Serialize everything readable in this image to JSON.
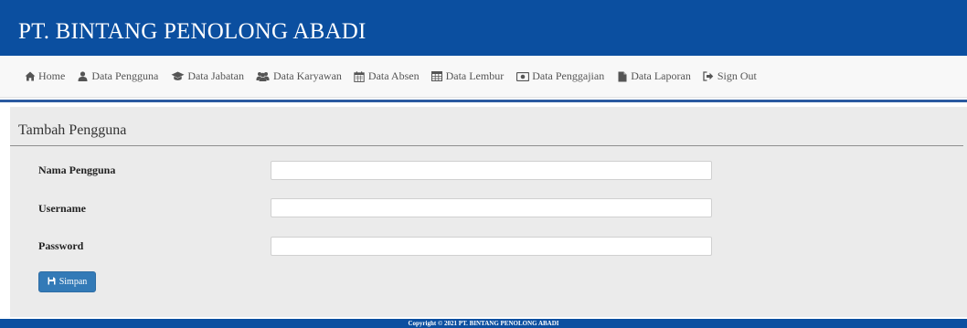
{
  "header": {
    "brand": "PT. BINTANG PENOLONG ABADI"
  },
  "nav": {
    "items": [
      {
        "label": "Home",
        "icon": "home-icon"
      },
      {
        "label": "Data Pengguna",
        "icon": "user-icon"
      },
      {
        "label": "Data Jabatan",
        "icon": "graduation-cap-icon"
      },
      {
        "label": "Data Karyawan",
        "icon": "users-icon"
      },
      {
        "label": "Data Absen",
        "icon": "calendar-icon"
      },
      {
        "label": "Data Lembur",
        "icon": "table-icon"
      },
      {
        "label": "Data Penggajian",
        "icon": "money-icon"
      },
      {
        "label": "Data Laporan",
        "icon": "file-icon"
      },
      {
        "label": "Sign Out",
        "icon": "sign-out-icon"
      }
    ]
  },
  "form": {
    "title": "Tambah Pengguna",
    "fields": {
      "nama": {
        "label": "Nama Pengguna",
        "value": ""
      },
      "username": {
        "label": "Username",
        "value": ""
      },
      "password": {
        "label": "Password",
        "value": ""
      }
    },
    "submit_label": "Simpan",
    "submit_icon": "floppy-disk-icon"
  },
  "footer": {
    "text": "Copyright © 2021 PT. BINTANG PENOLONG ABADI"
  },
  "colors": {
    "header_bg": "#0b4fa0",
    "accent_rule": "#2b5aa0",
    "button_bg": "#337ab7",
    "content_bg": "#ebebeb"
  }
}
